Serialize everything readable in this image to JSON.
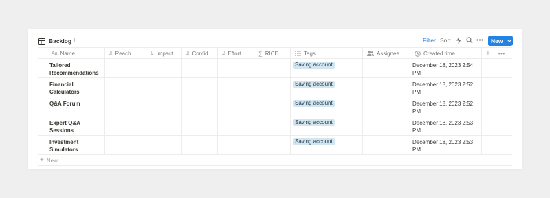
{
  "view": {
    "tab_label": "Backlog",
    "add_view": "+"
  },
  "toolbar": {
    "filter_label": "Filter",
    "sort_label": "Sort",
    "new_label": "New"
  },
  "columns": {
    "name": "Name",
    "reach": "Reach",
    "impact": "Impact",
    "confidence": "Confid...",
    "effort": "Effort",
    "rice": "RICE",
    "tags": "Tags",
    "assignee": "Assignee",
    "created_time": "Created time",
    "add_column": "+"
  },
  "rows": [
    {
      "name": "Tailored Recommendations",
      "tag": "Saving account",
      "created": "December 18, 2023 2:54 PM"
    },
    {
      "name": "Financial Calculators",
      "tag": "Saving account",
      "created": "December 18, 2023 2:52 PM"
    },
    {
      "name": "Q&A Forum",
      "tag": "Saving account",
      "created": "December 18, 2023 2:52 PM"
    },
    {
      "name": "Expert Q&A Sessions",
      "tag": "Saving account",
      "created": "December 18, 2023 2:53 PM"
    },
    {
      "name": "Investment Simulators",
      "tag": "Saving account",
      "created": "December 18, 2023 2:53 PM"
    }
  ],
  "footer": {
    "new_row_label": "New"
  },
  "colors": {
    "accent": "#2383e2",
    "tag_bg": "#d3e5ef",
    "tag_text": "#183347"
  }
}
